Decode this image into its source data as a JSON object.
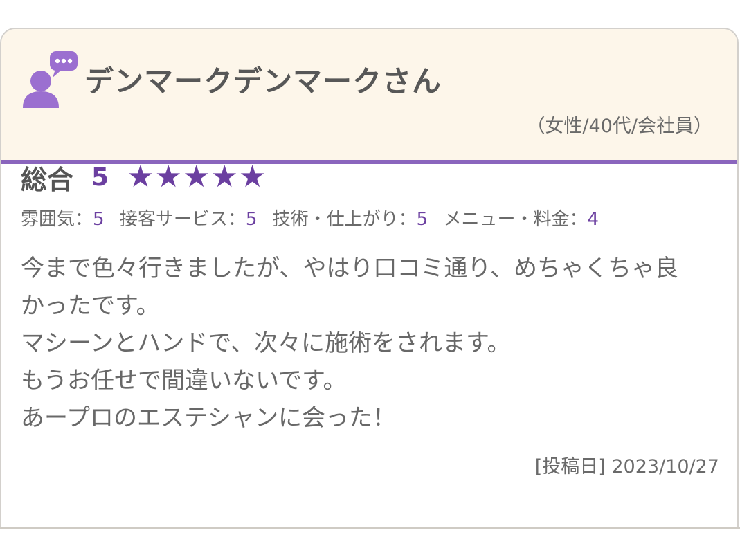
{
  "reviewer": {
    "name": "デンマークデンマークさん",
    "meta": "（女性/40代/会社員）",
    "avatar_icon": "user-speech-bubble-icon"
  },
  "rating": {
    "overall_label": "総合",
    "overall_score": "5",
    "stars_filled": 5,
    "stars_total": 5,
    "star_glyph": "★",
    "sub": [
      {
        "label": "雰囲気：",
        "value": "5"
      },
      {
        "label": "接客サービス：",
        "value": "5"
      },
      {
        "label": "技術・仕上がり：",
        "value": "5"
      },
      {
        "label": "メニュー・料金：",
        "value": "4"
      }
    ]
  },
  "comment": {
    "lines": [
      "今まで色々行きましたが、やはり口コミ通り、めちゃくちゃ良",
      "かったです。",
      "マシーンとハンドで、次々に施術をされます。",
      "もうお任せで間違いないです。",
      "あープロのエステシャンに会った！"
    ]
  },
  "posted": {
    "text": "[投稿日] 2023/10/27"
  },
  "colors": {
    "accent": "#6b3fa0",
    "header_bg": "#fdf6ea",
    "header_border": "#8a65bd",
    "avatar": "#9b6fd0"
  }
}
